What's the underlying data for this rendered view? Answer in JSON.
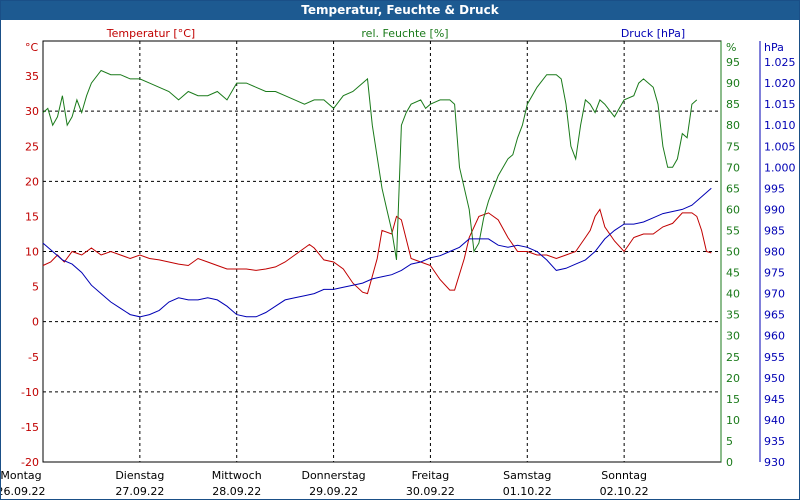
{
  "window": {
    "title": "Temperatur, Feuchte & Druck"
  },
  "colors": {
    "temperature": "#c00000",
    "humidity": "#1a7a1a",
    "pressure": "#0000b4",
    "grid": "#000000",
    "titlebar": "#1d5a91"
  },
  "chart_data": {
    "type": "line",
    "title": "Temperatur, Feuchte & Druck",
    "grid": true,
    "x_labels": [
      {
        "day": "Montag",
        "date": "26.09.22"
      },
      {
        "day": "Dienstag",
        "date": "27.09.22"
      },
      {
        "day": "Mittwoch",
        "date": "28.09.22"
      },
      {
        "day": "Donnerstag",
        "date": "29.09.22"
      },
      {
        "day": "Freitag",
        "date": "30.09.22"
      },
      {
        "day": "Samstag",
        "date": "01.10.22"
      },
      {
        "day": "Sonntag",
        "date": "02.10.22"
      }
    ],
    "x_range_days": [
      0,
      7
    ],
    "axes": {
      "temperature": {
        "label": "Temperatur [°C]",
        "unit": "°C",
        "range": [
          -20,
          40
        ],
        "ticks": [
          "35",
          "30",
          "25",
          "20",
          "15",
          "10",
          "5",
          "0",
          "-5",
          "-10",
          "-15",
          "-20"
        ]
      },
      "humidity": {
        "label": "rel. Feuchte [%]",
        "unit": "%",
        "range": [
          0,
          100
        ],
        "ticks": [
          "95",
          "90",
          "85",
          "80",
          "75",
          "70",
          "65",
          "60",
          "55",
          "50",
          "45",
          "40",
          "35",
          "30",
          "25",
          "20",
          "15",
          "10",
          "5",
          "0"
        ]
      },
      "pressure": {
        "label": "Druck [hPa]",
        "unit": "hPa",
        "range": [
          930,
          1030
        ],
        "ticks": [
          "1.025",
          "1.020",
          "1.015",
          "1.010",
          "1.005",
          "1.000",
          "995",
          "990",
          "985",
          "980",
          "975",
          "970",
          "965",
          "960",
          "955",
          "950",
          "945",
          "940",
          "935",
          "930"
        ]
      }
    },
    "series": [
      {
        "name": "Temperatur [°C]",
        "axis": "temperature",
        "color": "#c00000",
        "points": [
          [
            0,
            8
          ],
          [
            0.08,
            8.5
          ],
          [
            0.15,
            9.5
          ],
          [
            0.22,
            8.5
          ],
          [
            0.3,
            10
          ],
          [
            0.4,
            9.5
          ],
          [
            0.5,
            10.5
          ],
          [
            0.6,
            9.5
          ],
          [
            0.7,
            10
          ],
          [
            0.8,
            9.5
          ],
          [
            0.9,
            9
          ],
          [
            1.0,
            9.5
          ],
          [
            1.1,
            9
          ],
          [
            1.2,
            8.8
          ],
          [
            1.3,
            8.5
          ],
          [
            1.4,
            8.2
          ],
          [
            1.5,
            8
          ],
          [
            1.6,
            9
          ],
          [
            1.7,
            8.5
          ],
          [
            1.8,
            8
          ],
          [
            1.9,
            7.5
          ],
          [
            2.0,
            7.5
          ],
          [
            2.1,
            7.5
          ],
          [
            2.2,
            7.3
          ],
          [
            2.3,
            7.5
          ],
          [
            2.4,
            7.8
          ],
          [
            2.5,
            8.5
          ],
          [
            2.6,
            9.5
          ],
          [
            2.7,
            10.5
          ],
          [
            2.75,
            11
          ],
          [
            2.8,
            10.5
          ],
          [
            2.9,
            8.8
          ],
          [
            3.0,
            8.5
          ],
          [
            3.1,
            7.5
          ],
          [
            3.2,
            5.5
          ],
          [
            3.3,
            4.2
          ],
          [
            3.35,
            4
          ],
          [
            3.45,
            9
          ],
          [
            3.5,
            13
          ],
          [
            3.6,
            12.5
          ],
          [
            3.65,
            15
          ],
          [
            3.7,
            14.5
          ],
          [
            3.8,
            9
          ],
          [
            3.9,
            8.5
          ],
          [
            4.0,
            8
          ],
          [
            4.1,
            6
          ],
          [
            4.2,
            4.5
          ],
          [
            4.25,
            4.5
          ],
          [
            4.35,
            9
          ],
          [
            4.4,
            12
          ],
          [
            4.5,
            15
          ],
          [
            4.6,
            15.5
          ],
          [
            4.7,
            14.5
          ],
          [
            4.8,
            12
          ],
          [
            4.9,
            10
          ],
          [
            5.0,
            10
          ],
          [
            5.1,
            9.5
          ],
          [
            5.2,
            9.5
          ],
          [
            5.3,
            9
          ],
          [
            5.4,
            9.5
          ],
          [
            5.5,
            10
          ],
          [
            5.6,
            12
          ],
          [
            5.65,
            13
          ],
          [
            5.7,
            15
          ],
          [
            5.75,
            16
          ],
          [
            5.8,
            13.5
          ],
          [
            5.9,
            11.5
          ],
          [
            6.0,
            10
          ],
          [
            6.05,
            11
          ],
          [
            6.1,
            12
          ],
          [
            6.2,
            12.5
          ],
          [
            6.3,
            12.5
          ],
          [
            6.4,
            13.5
          ],
          [
            6.5,
            14
          ],
          [
            6.6,
            15.5
          ],
          [
            6.7,
            15.5
          ],
          [
            6.75,
            15
          ],
          [
            6.8,
            13
          ],
          [
            6.85,
            10
          ],
          [
            6.9,
            9.8
          ]
        ]
      },
      {
        "name": "rel. Feuchte [%]",
        "axis": "humidity",
        "color": "#1a7a1a",
        "points": [
          [
            0,
            83
          ],
          [
            0.05,
            84
          ],
          [
            0.1,
            80
          ],
          [
            0.15,
            82
          ],
          [
            0.2,
            87
          ],
          [
            0.25,
            80
          ],
          [
            0.3,
            82
          ],
          [
            0.35,
            86
          ],
          [
            0.4,
            83
          ],
          [
            0.45,
            87
          ],
          [
            0.5,
            90
          ],
          [
            0.6,
            93
          ],
          [
            0.7,
            92
          ],
          [
            0.8,
            92
          ],
          [
            0.9,
            91
          ],
          [
            1.0,
            91
          ],
          [
            1.1,
            90
          ],
          [
            1.2,
            89
          ],
          [
            1.3,
            88
          ],
          [
            1.4,
            86
          ],
          [
            1.5,
            88
          ],
          [
            1.6,
            87
          ],
          [
            1.7,
            87
          ],
          [
            1.8,
            88
          ],
          [
            1.9,
            86
          ],
          [
            2.0,
            90
          ],
          [
            2.1,
            90
          ],
          [
            2.2,
            89
          ],
          [
            2.3,
            88
          ],
          [
            2.4,
            88
          ],
          [
            2.5,
            87
          ],
          [
            2.6,
            86
          ],
          [
            2.7,
            85
          ],
          [
            2.8,
            86
          ],
          [
            2.9,
            86
          ],
          [
            3.0,
            84
          ],
          [
            3.1,
            87
          ],
          [
            3.2,
            88
          ],
          [
            3.3,
            90
          ],
          [
            3.35,
            91
          ],
          [
            3.4,
            80
          ],
          [
            3.5,
            65
          ],
          [
            3.55,
            60
          ],
          [
            3.6,
            55
          ],
          [
            3.65,
            48
          ],
          [
            3.7,
            80
          ],
          [
            3.75,
            83
          ],
          [
            3.8,
            85
          ],
          [
            3.9,
            86
          ],
          [
            3.95,
            84
          ],
          [
            4.0,
            85
          ],
          [
            4.1,
            86
          ],
          [
            4.2,
            86
          ],
          [
            4.25,
            85
          ],
          [
            4.3,
            70
          ],
          [
            4.4,
            60
          ],
          [
            4.45,
            50
          ],
          [
            4.5,
            52
          ],
          [
            4.55,
            58
          ],
          [
            4.6,
            62
          ],
          [
            4.7,
            68
          ],
          [
            4.8,
            72
          ],
          [
            4.85,
            73
          ],
          [
            4.9,
            77
          ],
          [
            4.95,
            80
          ],
          [
            5.0,
            85
          ],
          [
            5.1,
            89
          ],
          [
            5.2,
            92
          ],
          [
            5.3,
            92
          ],
          [
            5.35,
            91
          ],
          [
            5.4,
            85
          ],
          [
            5.45,
            75
          ],
          [
            5.5,
            72
          ],
          [
            5.55,
            80
          ],
          [
            5.6,
            86
          ],
          [
            5.65,
            85
          ],
          [
            5.7,
            83
          ],
          [
            5.75,
            86
          ],
          [
            5.8,
            85
          ],
          [
            5.9,
            82
          ],
          [
            6.0,
            86
          ],
          [
            6.1,
            87
          ],
          [
            6.15,
            90
          ],
          [
            6.2,
            91
          ],
          [
            6.3,
            89
          ],
          [
            6.35,
            85
          ],
          [
            6.4,
            75
          ],
          [
            6.45,
            70
          ],
          [
            6.5,
            70
          ],
          [
            6.55,
            72
          ],
          [
            6.6,
            78
          ],
          [
            6.65,
            77
          ],
          [
            6.7,
            85
          ],
          [
            6.75,
            86
          ]
        ]
      },
      {
        "name": "Druck [hPa]",
        "axis": "pressure",
        "color": "#0000b4",
        "points": [
          [
            0,
            982
          ],
          [
            0.1,
            980
          ],
          [
            0.2,
            978
          ],
          [
            0.3,
            977
          ],
          [
            0.4,
            975
          ],
          [
            0.5,
            972
          ],
          [
            0.6,
            970
          ],
          [
            0.7,
            968
          ],
          [
            0.8,
            966.5
          ],
          [
            0.9,
            965
          ],
          [
            1.0,
            964.5
          ],
          [
            1.1,
            965
          ],
          [
            1.2,
            966
          ],
          [
            1.3,
            968
          ],
          [
            1.4,
            969
          ],
          [
            1.5,
            968.5
          ],
          [
            1.6,
            968.5
          ],
          [
            1.7,
            969
          ],
          [
            1.8,
            968.5
          ],
          [
            1.9,
            967
          ],
          [
            2.0,
            965
          ],
          [
            2.1,
            964.5
          ],
          [
            2.2,
            964.5
          ],
          [
            2.3,
            965.5
          ],
          [
            2.4,
            967
          ],
          [
            2.5,
            968.5
          ],
          [
            2.6,
            969
          ],
          [
            2.7,
            969.5
          ],
          [
            2.8,
            970
          ],
          [
            2.9,
            971
          ],
          [
            3.0,
            971
          ],
          [
            3.1,
            971.5
          ],
          [
            3.2,
            972
          ],
          [
            3.3,
            972.5
          ],
          [
            3.4,
            973.5
          ],
          [
            3.5,
            974
          ],
          [
            3.6,
            974.5
          ],
          [
            3.7,
            975.5
          ],
          [
            3.8,
            977
          ],
          [
            3.9,
            977.5
          ],
          [
            4.0,
            978.5
          ],
          [
            4.1,
            979
          ],
          [
            4.2,
            980
          ],
          [
            4.3,
            981
          ],
          [
            4.4,
            983
          ],
          [
            4.5,
            983
          ],
          [
            4.6,
            983
          ],
          [
            4.7,
            981.5
          ],
          [
            4.8,
            981
          ],
          [
            4.9,
            981.5
          ],
          [
            5.0,
            981
          ],
          [
            5.1,
            980
          ],
          [
            5.2,
            978
          ],
          [
            5.3,
            975.5
          ],
          [
            5.4,
            976
          ],
          [
            5.5,
            977
          ],
          [
            5.6,
            978
          ],
          [
            5.7,
            980
          ],
          [
            5.8,
            983
          ],
          [
            5.9,
            985
          ],
          [
            6.0,
            986.5
          ],
          [
            6.1,
            986.5
          ],
          [
            6.2,
            987
          ],
          [
            6.3,
            988
          ],
          [
            6.4,
            989
          ],
          [
            6.5,
            989.5
          ],
          [
            6.6,
            990
          ],
          [
            6.7,
            991
          ],
          [
            6.8,
            993
          ],
          [
            6.9,
            995
          ]
        ]
      }
    ]
  }
}
